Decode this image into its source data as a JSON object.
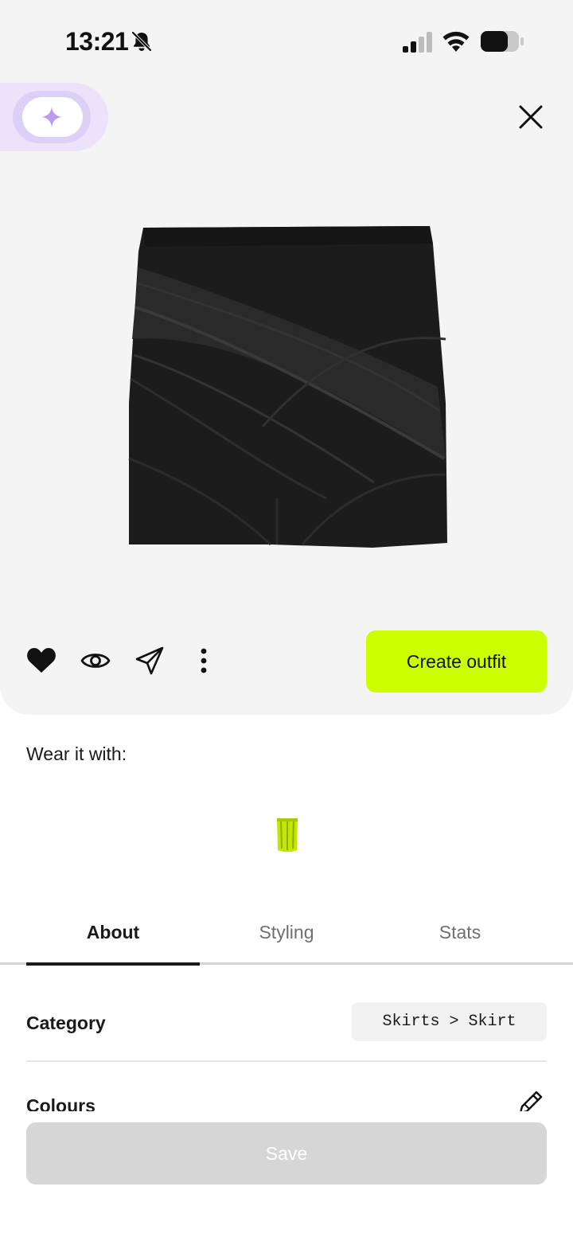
{
  "status_bar": {
    "time": "13:21",
    "icons": [
      "bell-off-icon",
      "signal-icon",
      "wifi-icon",
      "battery-icon"
    ]
  },
  "header": {
    "ai_button_icon": "sparkle-icon",
    "close_icon": "close-icon"
  },
  "product": {
    "image": "black draped mini skirt"
  },
  "actions": {
    "icons": [
      "heart-icon",
      "eye-icon",
      "send-icon",
      "more-icon"
    ],
    "create_outfit_label": "Create outfit"
  },
  "wear_it_with": {
    "title": "Wear it with:",
    "items": [
      "lime green item"
    ]
  },
  "tabs": {
    "items": [
      {
        "label": "About",
        "active": true
      },
      {
        "label": "Styling",
        "active": false
      },
      {
        "label": "Stats",
        "active": false
      }
    ]
  },
  "about": {
    "category_label": "Category",
    "category_value": "Skirts > Skirt",
    "colours_label": "Colours"
  },
  "footer": {
    "save_label": "Save"
  },
  "colors": {
    "accent": "#ccff00",
    "ai_tint": "#ece3fb",
    "sparkle": "#b99cf2",
    "panel": "#f4f4f4",
    "disabled_button": "#d6d6d6"
  }
}
